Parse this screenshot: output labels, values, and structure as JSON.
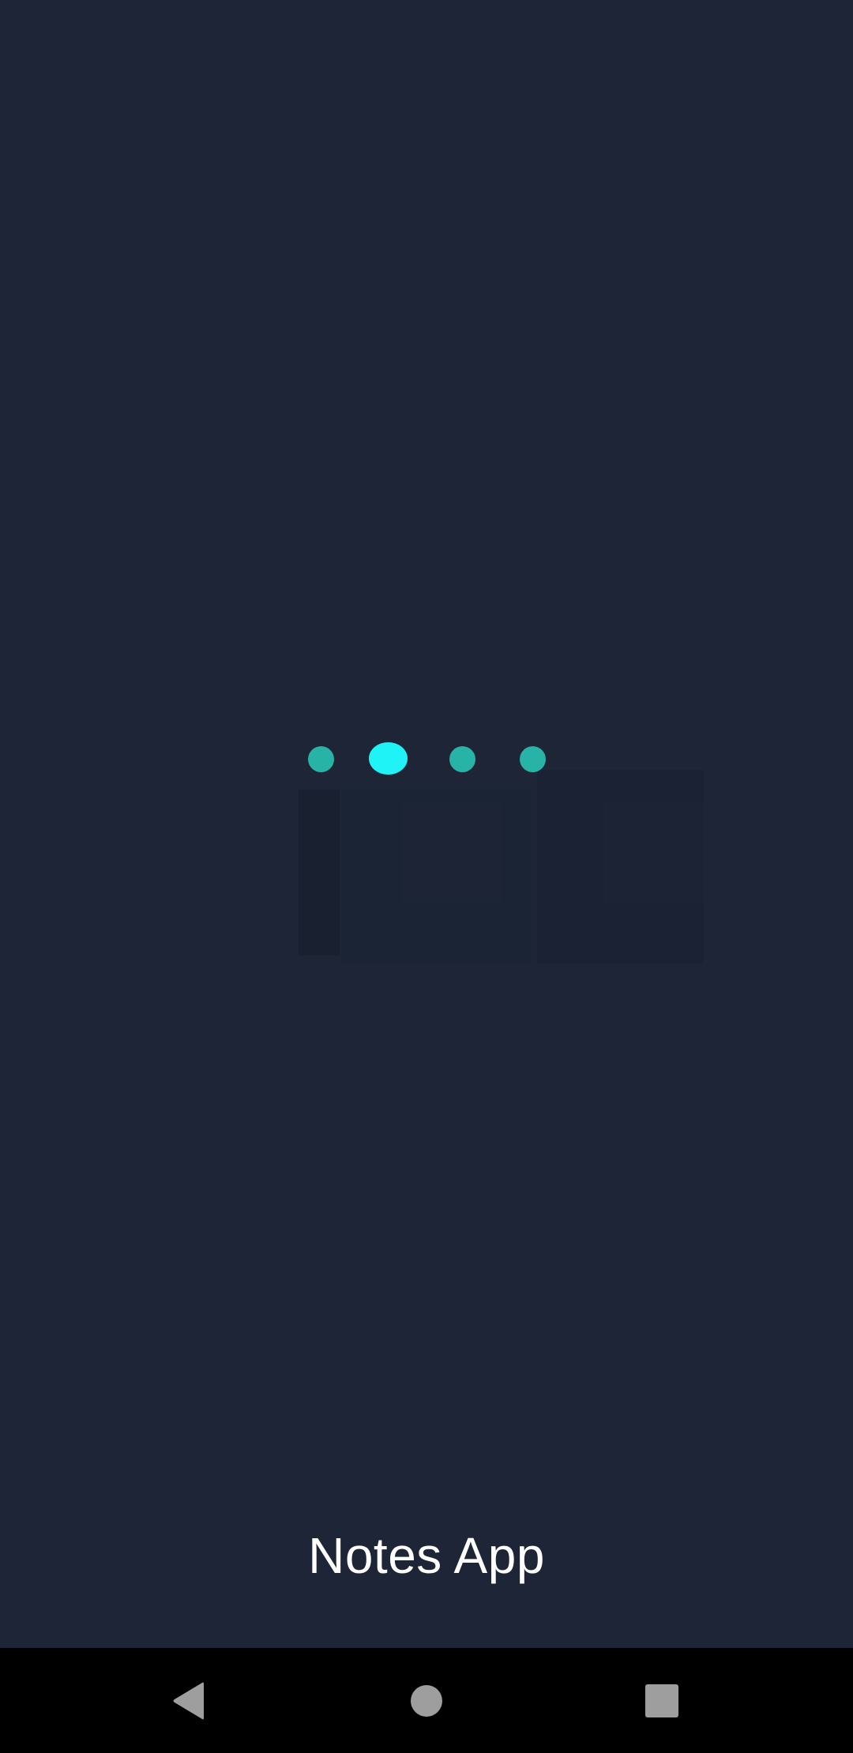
{
  "app": {
    "title": "Notes App"
  },
  "loader": {
    "dots": 4,
    "active_dot_index": 1,
    "active_color": "#20f3f6",
    "inactive_color": "#27b4a6"
  },
  "colors": {
    "background": "#1d2537",
    "nav_background": "#000000",
    "nav_icon": "#9e9e9e",
    "title_text": "#ffffff"
  },
  "navigation": {
    "buttons": [
      {
        "name": "back",
        "icon": "triangle-back-icon"
      },
      {
        "name": "home",
        "icon": "circle-home-icon"
      },
      {
        "name": "recents",
        "icon": "square-recents-icon"
      }
    ]
  }
}
